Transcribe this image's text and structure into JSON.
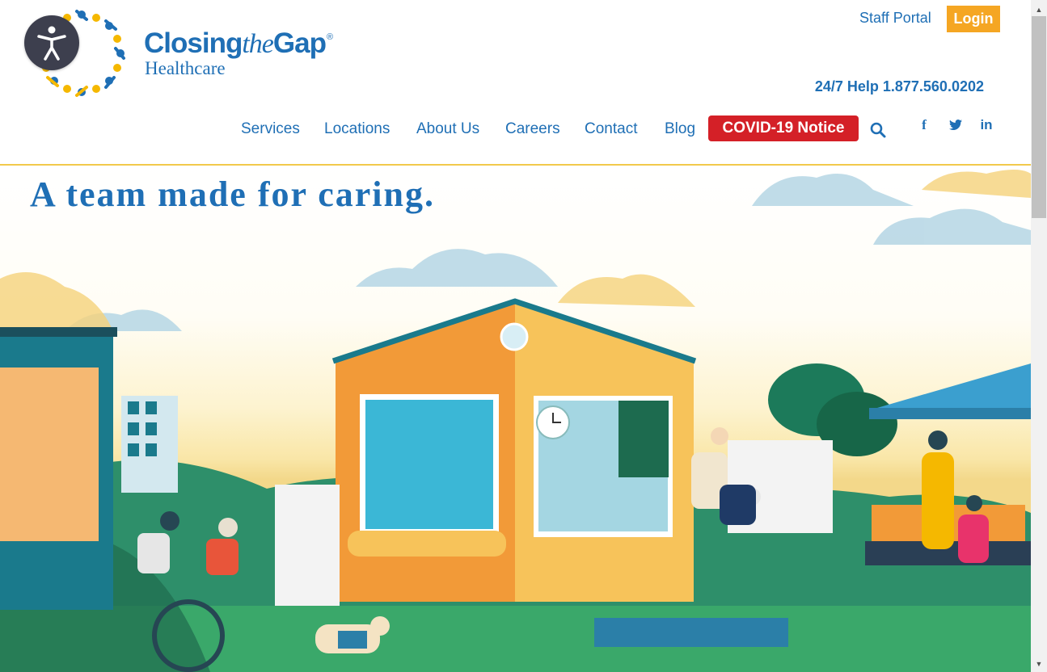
{
  "logo": {
    "brand_pre": "Closing",
    "brand_the": "the",
    "brand_post": "Gap",
    "registered": "®",
    "sub": "Healthcare"
  },
  "accessibility": {
    "icon": "accessibility-icon"
  },
  "top_links": {
    "staff_portal": "Staff Portal",
    "login": "Login"
  },
  "help": {
    "text": "24/7 Help 1.877.560.0202"
  },
  "nav": {
    "items": [
      {
        "label": "Services"
      },
      {
        "label": "Locations"
      },
      {
        "label": "About Us"
      },
      {
        "label": "Careers"
      },
      {
        "label": "Contact"
      },
      {
        "label": "Blog"
      }
    ],
    "covid": "COVID-19 Notice",
    "search_icon": "search-icon"
  },
  "social": {
    "facebook": "f",
    "twitter": "twitter-icon",
    "linkedin": "in"
  },
  "hero": {
    "title": "A team made for caring."
  },
  "colors": {
    "brand_blue": "#1f6fb5",
    "login_orange": "#f5a623",
    "covid_red": "#d42027",
    "divider_yellow": "#f2c94c"
  }
}
